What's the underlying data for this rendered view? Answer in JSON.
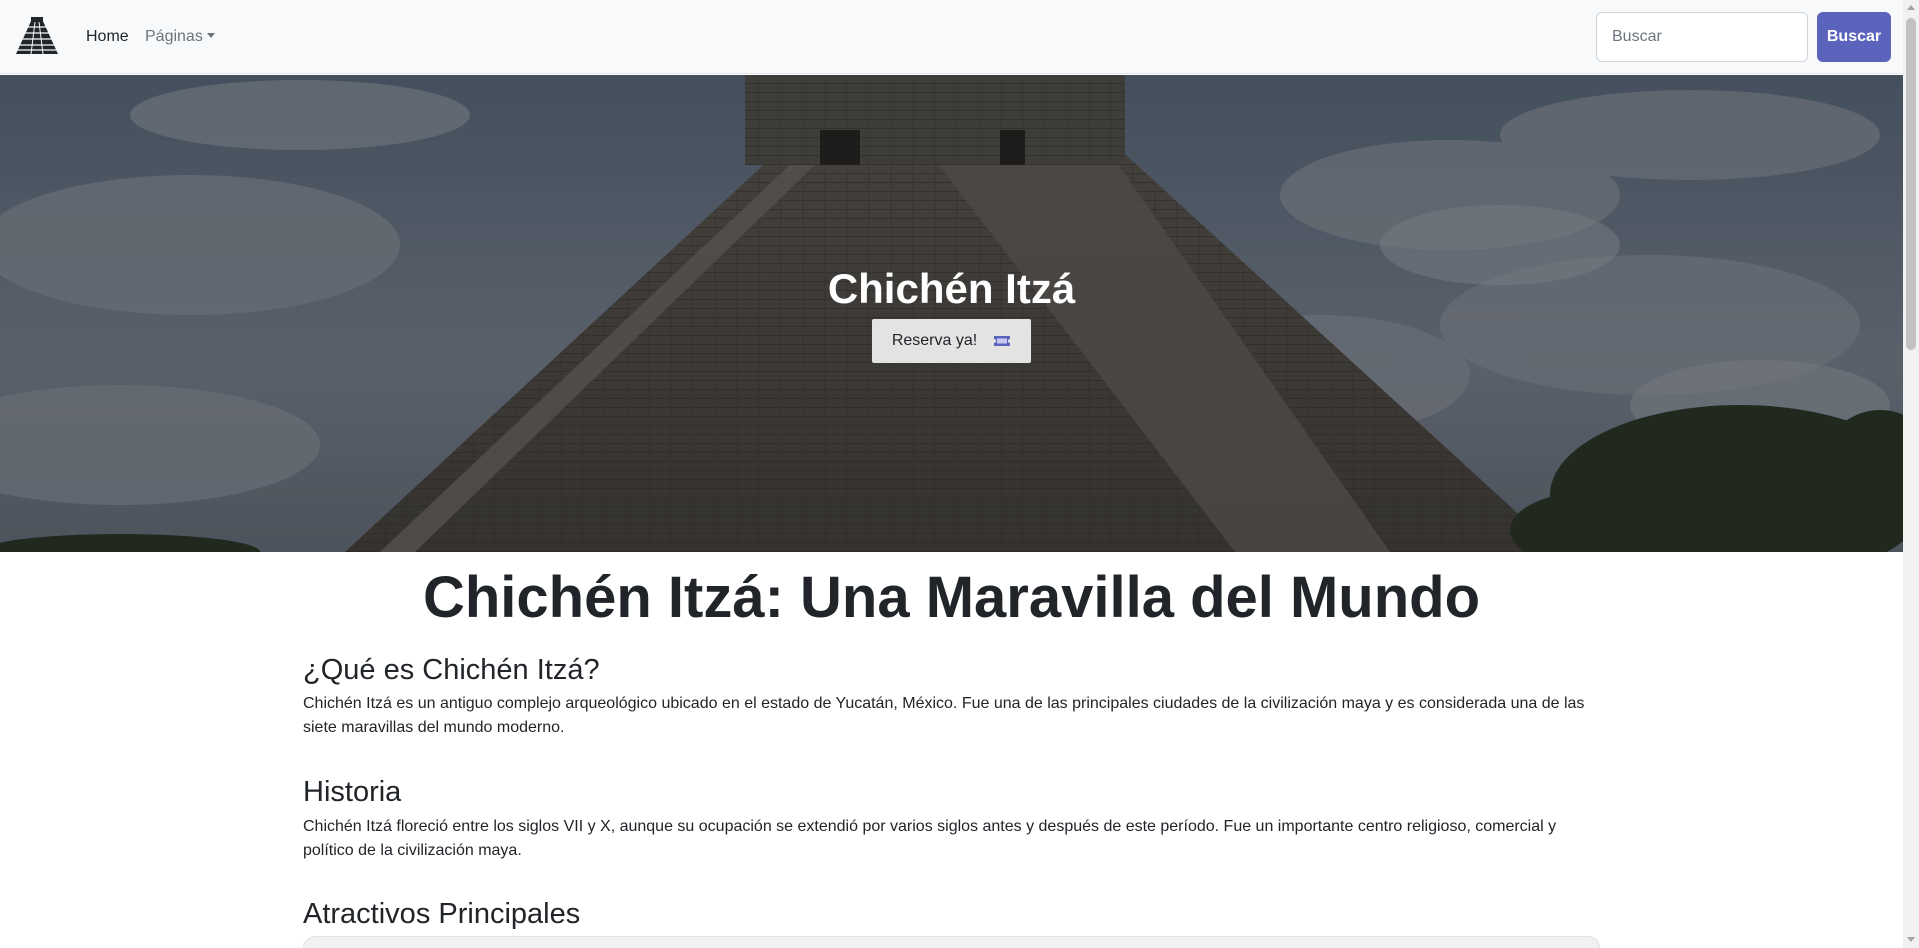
{
  "navbar": {
    "brand_icon": "pyramid-logo-icon",
    "home_label": "Home",
    "pages_label": "Páginas",
    "search_placeholder": "Buscar",
    "search_button": "Buscar"
  },
  "hero": {
    "title": "Chichén Itzá",
    "reserve_label": "Reserva ya!",
    "reserve_icon": "ticket-icon",
    "accent_color": "#5c63bd"
  },
  "content": {
    "main_title": "Chichén Itzá: Una Maravilla del Mundo",
    "sections": [
      {
        "heading": "¿Qué es Chichén Itzá?",
        "paragraph": "Chichén Itzá es un antiguo complejo arqueológico ubicado en el estado de Yucatán, México. Fue una de las principales ciudades de la civilización maya y es considerada una de las siete maravillas del mundo moderno."
      },
      {
        "heading": "Historia",
        "paragraph": "Chichén Itzá floreció entre los siglos VII y X, aunque su ocupación se extendió por varios siglos antes y después de este período. Fue un importante centro religioso, comercial y político de la civilización maya."
      },
      {
        "heading": "Atractivos Principales"
      }
    ]
  }
}
